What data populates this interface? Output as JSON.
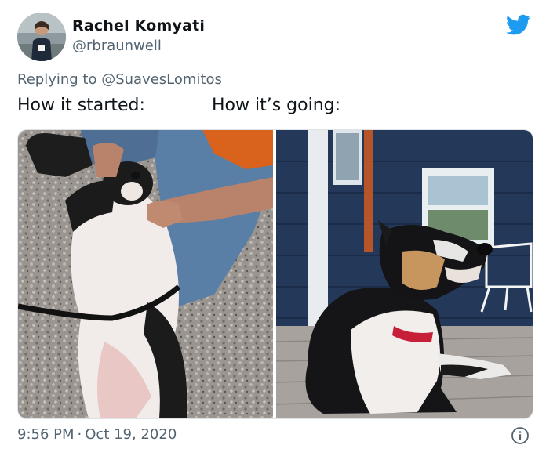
{
  "author": {
    "name": "Rachel Komyati",
    "handle": "@rbraunwell",
    "avatar_icon": "avatar-photo"
  },
  "brand": {
    "icon": "twitter-bird-icon",
    "color": "#1d9bf0"
  },
  "reply": {
    "prefix": "Replying to ",
    "mention": "@SuavesLomitos"
  },
  "captions": {
    "left": "How it started:",
    "right": "How it’s going:"
  },
  "media": {
    "photos": [
      {
        "subject": "dog-on-back-photo"
      },
      {
        "subject": "dog-on-porch-photo"
      }
    ]
  },
  "meta": {
    "time": "9:56 PM",
    "separator": "·",
    "date": "Oct 19, 2020",
    "info_icon": "info-icon"
  },
  "colors": {
    "text_primary": "#0f1419",
    "text_secondary": "#536471",
    "border": "#dfe3e6"
  }
}
